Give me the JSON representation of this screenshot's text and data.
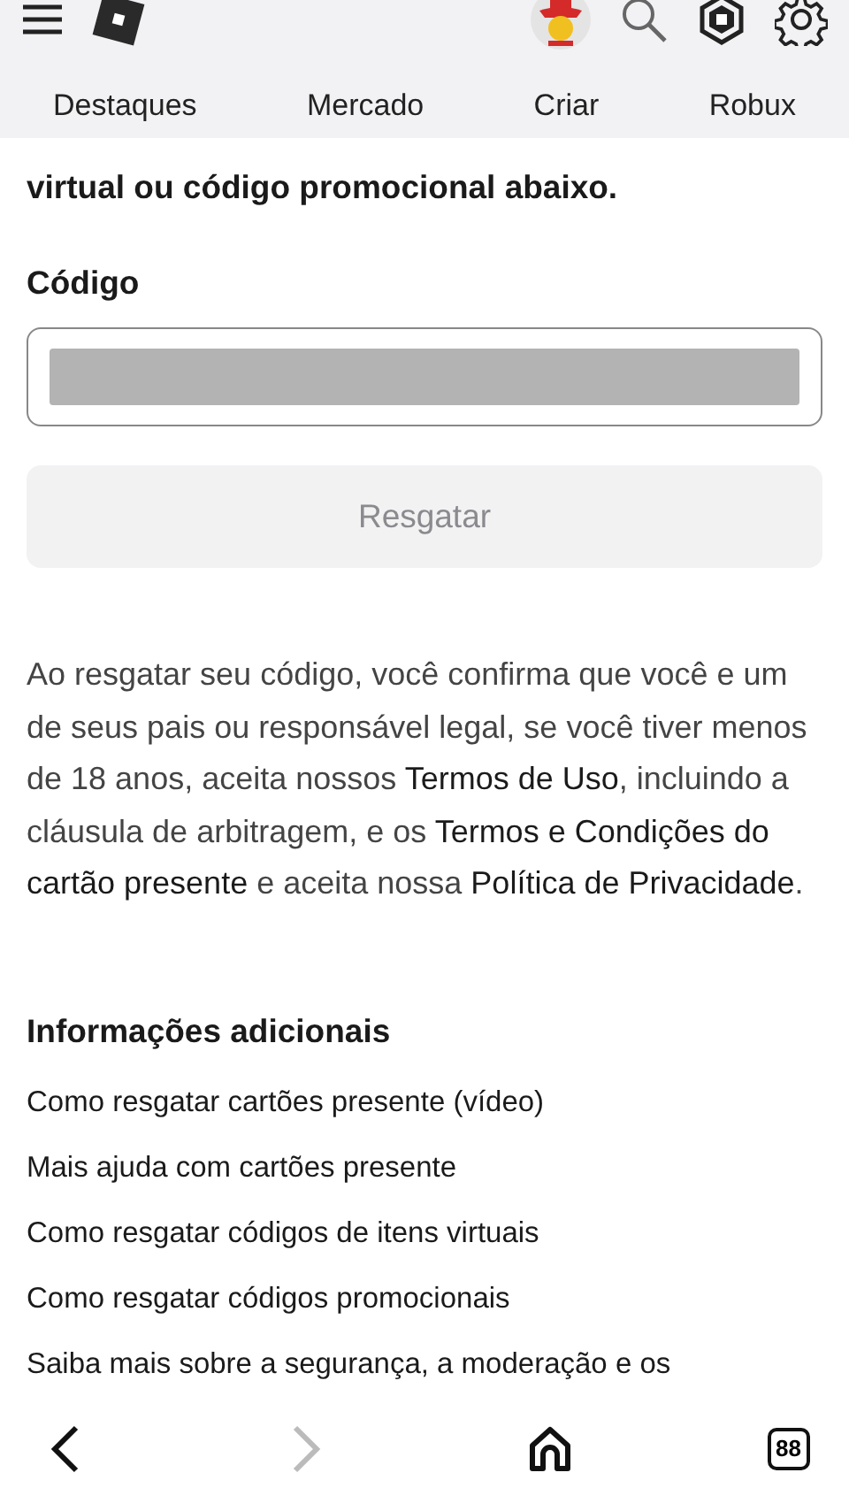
{
  "nav_tabs": [
    {
      "label": "Destaques"
    },
    {
      "label": "Mercado"
    },
    {
      "label": "Criar"
    },
    {
      "label": "Robux"
    }
  ],
  "intro": [
    "virtual ou código promocional abaixo."
  ],
  "code_field": {
    "label": "Código",
    "masked": true
  },
  "redeem_button": {
    "label": "Resgatar",
    "disabled": true
  },
  "legal_text": "Ao resgatar seu código, você confirma que você e um de seus pais ou responsável legal, se você tiver menos de 18 anos, aceita nossos **Termos de Uso**, incluindo a cláusula de arbitragem, e os **Termos e Condições do cartão presente** e aceita nossa **Política de Privacidade**.",
  "additional_info": {
    "title": "Informações adicionais",
    "links": [
      "Como resgatar cartões presente (vídeo)",
      "Mais ajuda com cartões presente",
      "Como resgatar códigos de itens virtuais",
      "Como resgatar códigos promocionais",
      "Saiba mais sobre a segurança, a moderação e os"
    ]
  },
  "browser_bar": {
    "back_disabled": false,
    "forward_disabled": true,
    "tab_count": "88"
  }
}
